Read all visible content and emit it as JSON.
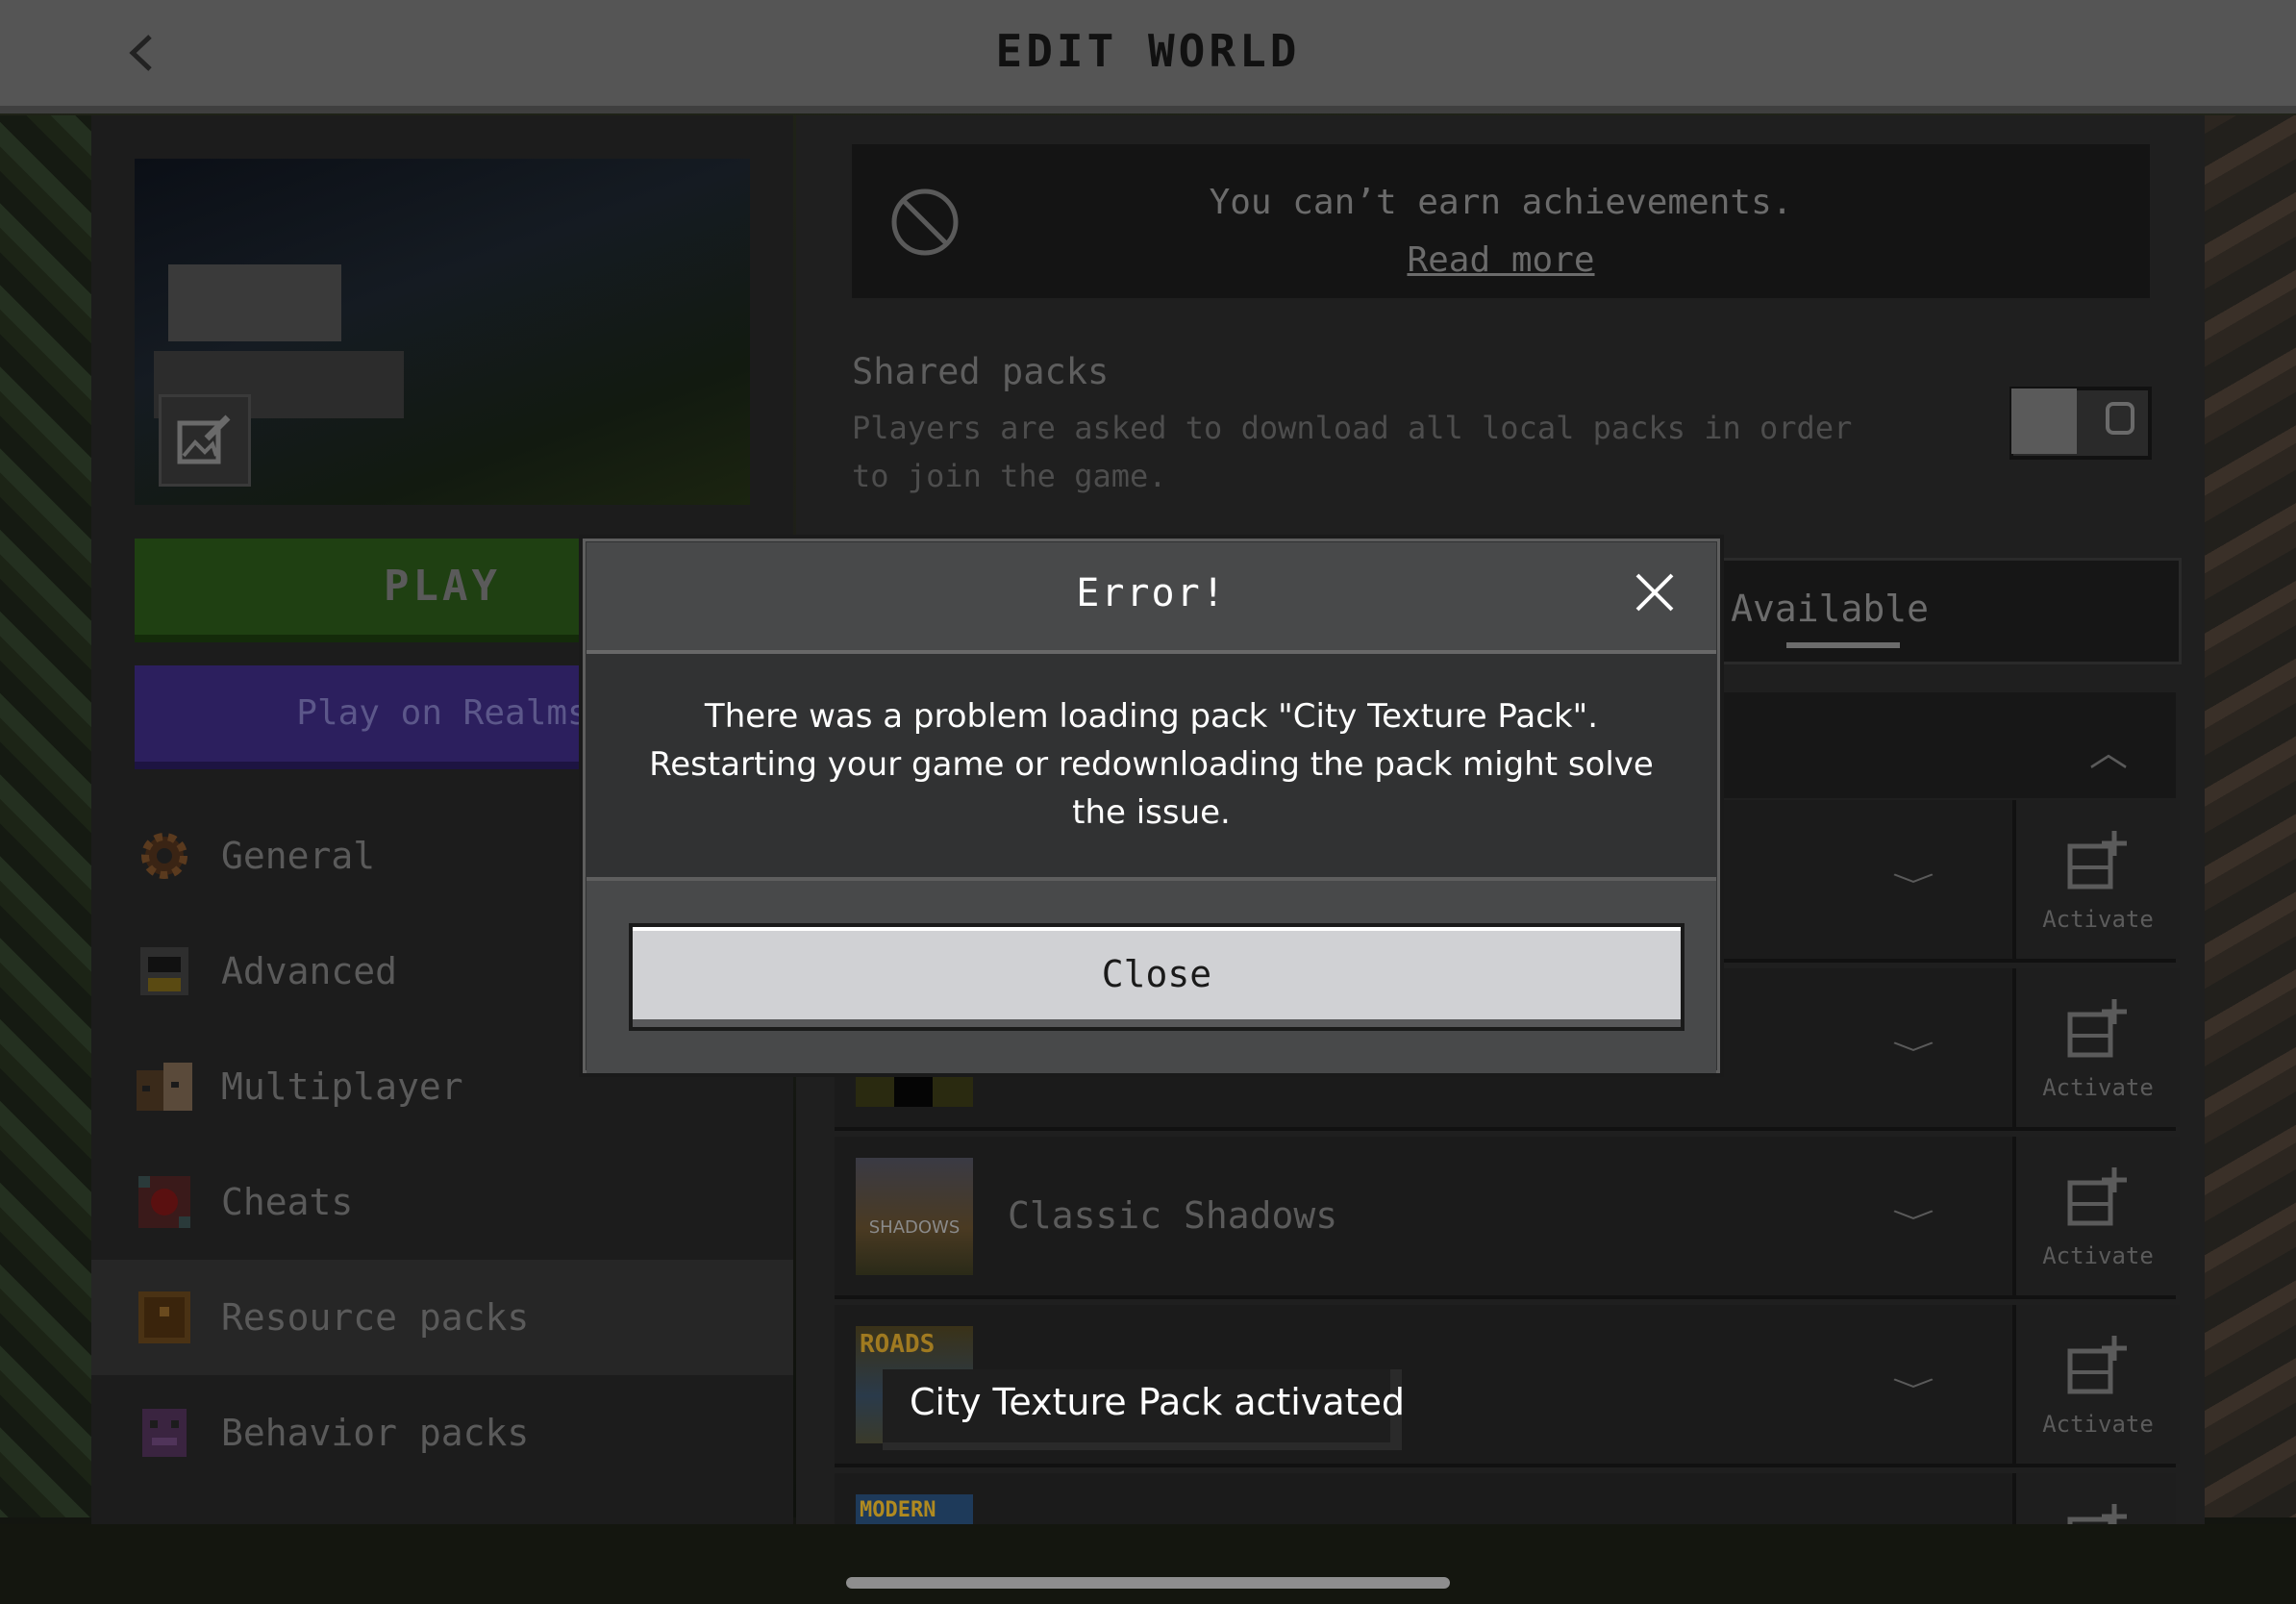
{
  "header": {
    "title": "EDIT WORLD",
    "back_icon": "chevron-left-icon"
  },
  "left_panel": {
    "play_label": "PLAY",
    "realms_label": "Play on Realms",
    "nav": [
      {
        "label": "General",
        "icon": "gear-icon",
        "active": false
      },
      {
        "label": "Advanced",
        "icon": "advanced-icon",
        "active": false
      },
      {
        "label": "Multiplayer",
        "icon": "multiplayer-icon",
        "active": false
      },
      {
        "label": "Cheats",
        "icon": "cheats-icon",
        "active": false
      },
      {
        "label": "Resource packs",
        "icon": "resource-pack-icon",
        "active": true
      },
      {
        "label": "Behavior packs",
        "icon": "behavior-pack-icon",
        "active": false
      }
    ]
  },
  "right_panel": {
    "achievements": {
      "text": "You can’t earn achievements.",
      "link": "Read more"
    },
    "shared_packs": {
      "title": "Shared packs",
      "description": "Players are asked to download all local packs in order to join the game.",
      "toggle_on": false
    },
    "tab_available": "Available",
    "packs": [
      {
        "name": "",
        "action": "Activate"
      },
      {
        "name": "",
        "action": "Activate"
      },
      {
        "name": "Classic Shadows",
        "thumb_text": "SHADOWS",
        "action": "Activate"
      },
      {
        "name": "",
        "thumb_text": "ROADS",
        "action": "Activate"
      },
      {
        "name": "",
        "thumb_text": "MODERN",
        "action": ""
      }
    ]
  },
  "modal": {
    "title": "Error!",
    "message": "There was a problem loading pack \"City Texture Pack\". Restarting your game or redownloading the pack might solve the issue.",
    "close_button": "Close"
  },
  "toast": {
    "text": "City Texture Pack activated"
  },
  "colors": {
    "play_green": "#1f4012",
    "realms_purple": "#2c1f5e",
    "header_gray": "#555555",
    "modal_gray": "#48494a"
  }
}
